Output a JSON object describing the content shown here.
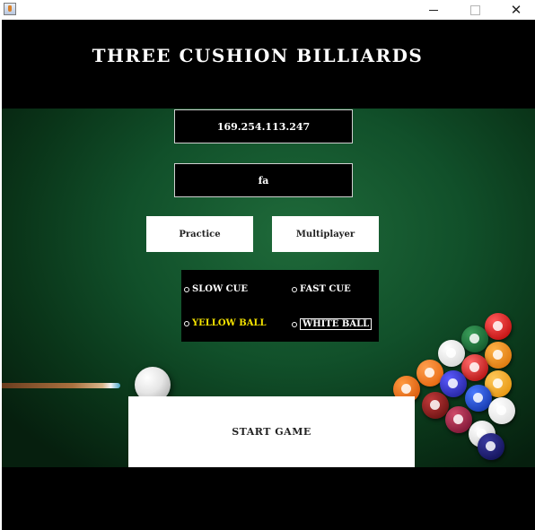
{
  "window": {
    "title": "",
    "controls": {
      "minimize": "minimize",
      "maximize": "maximize",
      "close": "✕"
    }
  },
  "app": {
    "title": "THREE CUSHION BILLIARDS",
    "server_ip_value": "169.254.113.247",
    "player_name_value": "fa",
    "mode_buttons": {
      "practice": "Practice",
      "multiplayer": "Multiplayer"
    },
    "options": {
      "slow_cue": "SLOW CUE",
      "fast_cue": "FAST CUE",
      "yellow_ball": "YELLOW BALL",
      "white_ball": "WHITE BALL"
    },
    "start_button": "START GAME"
  },
  "colors": {
    "felt": "#11502a",
    "yellow_option": "#f5e300",
    "background": "#000000",
    "button": "#ffffff"
  },
  "icons": {
    "app_icon": "java-cup-icon",
    "cue": "cue-stick-image",
    "cue_ball": "cue-ball-image",
    "rack": "billiard-balls-rack-image"
  }
}
